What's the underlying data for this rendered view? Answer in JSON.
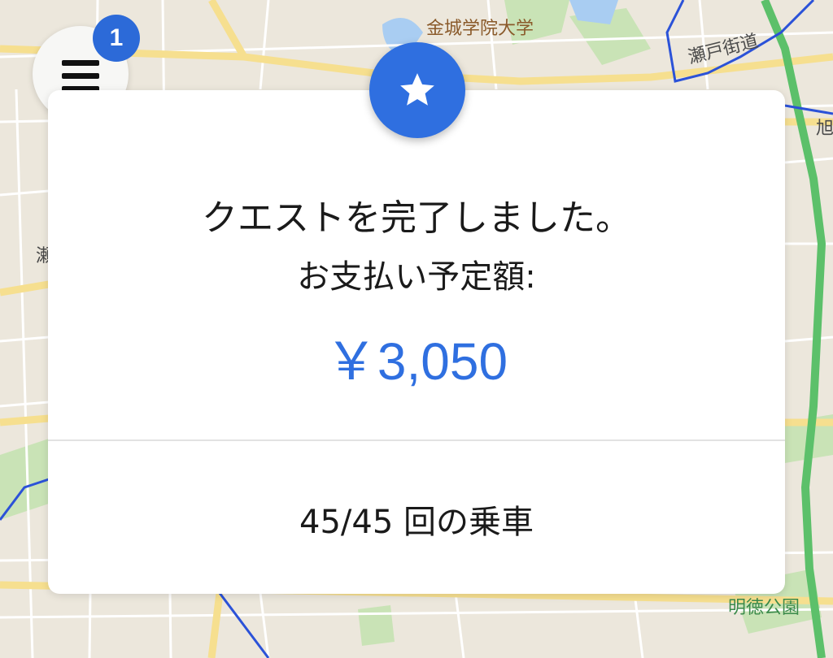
{
  "map": {
    "labels": {
      "university": "金城学院大学",
      "seto_kaido": "瀬戸街道",
      "park": "明徳公園",
      "edge_right": "旭",
      "edge_left": "瀬"
    }
  },
  "menu": {
    "badge_count": "1",
    "icon": "hamburger-menu-icon"
  },
  "quest": {
    "star_icon": "star-icon",
    "title": "クエストを完了しました。",
    "subtitle": "お支払い予定額:",
    "amount": "￥3,050",
    "rides": "45/45 回の乗車"
  },
  "colors": {
    "accent": "#2f6fe0",
    "badge": "#2c6ad8",
    "highway": "#5cc06a",
    "boundary": "#2b52d8"
  }
}
